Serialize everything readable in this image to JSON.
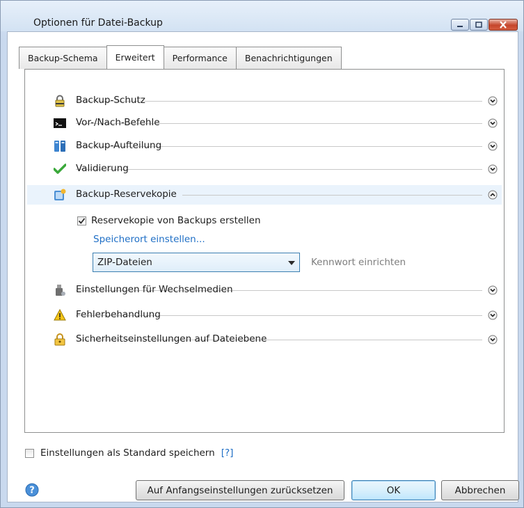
{
  "window": {
    "title": "Optionen für Datei-Backup"
  },
  "tabs": [
    {
      "label": "Backup-Schema"
    },
    {
      "label": "Erweitert",
      "active": true
    },
    {
      "label": "Performance"
    },
    {
      "label": "Benachrichtigungen"
    }
  ],
  "sections": [
    {
      "label": "Backup-Schutz",
      "icon": "lock-icon",
      "expanded": false
    },
    {
      "label": "Vor-/Nach-Befehle",
      "icon": "terminal-icon",
      "expanded": false
    },
    {
      "label": "Backup-Aufteilung",
      "icon": "split-icon",
      "expanded": false
    },
    {
      "label": "Validierung",
      "icon": "checkmark-icon",
      "expanded": false
    },
    {
      "label": "Backup-Reservekopie",
      "icon": "reserve-copy-icon",
      "expanded": true
    },
    {
      "label": "Einstellungen für Wechselmedien",
      "icon": "usb-drive-icon",
      "expanded": false
    },
    {
      "label": "Fehlerbehandlung",
      "icon": "warning-icon",
      "expanded": false
    },
    {
      "label": "Sicherheitseinstellungen auf Dateiebene",
      "icon": "file-lock-icon",
      "expanded": false
    }
  ],
  "reserve": {
    "checkbox_label": "Reservekopie von Backups erstellen",
    "checked": true,
    "location_link": "Speicherort einstellen...",
    "format_value": "ZIP-Dateien",
    "password_link": "Kennwort einrichten"
  },
  "footer": {
    "default_checkbox_label": "Einstellungen als Standard speichern",
    "help_link": "[?]",
    "reset_button": "Auf Anfangseinstellungen zurücksetzen",
    "ok_button": "OK",
    "cancel_button": "Abbrechen"
  },
  "colors": {
    "accent": "#1f6fc6",
    "selected_row": "#eaf3fc",
    "check": "#3aa83a"
  }
}
